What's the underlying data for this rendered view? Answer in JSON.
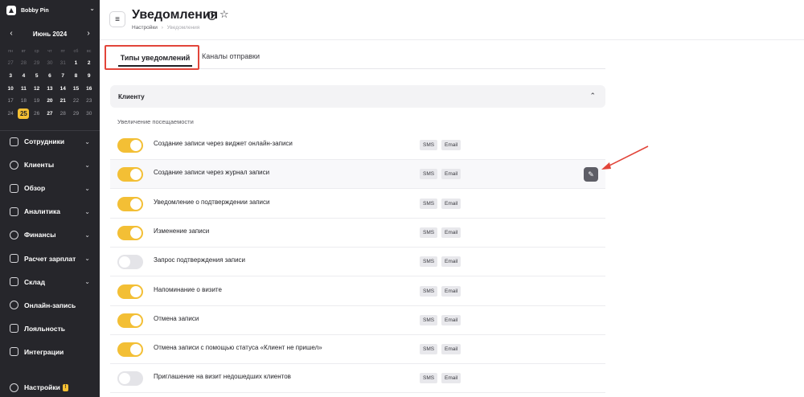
{
  "sidebar": {
    "org_name": "Bobby Pin",
    "calendar": {
      "month_label": "Июнь 2024",
      "weekdays": [
        "пн",
        "вт",
        "ср",
        "чт",
        "пт",
        "сб",
        "вс"
      ],
      "weeks": [
        [
          {
            "d": "27",
            "s": "muted"
          },
          {
            "d": "28",
            "s": "muted"
          },
          {
            "d": "29",
            "s": "muted"
          },
          {
            "d": "30",
            "s": "muted"
          },
          {
            "d": "31",
            "s": "muted"
          },
          {
            "d": "1",
            "s": ""
          },
          {
            "d": "2",
            "s": ""
          }
        ],
        [
          {
            "d": "3",
            "s": ""
          },
          {
            "d": "4",
            "s": ""
          },
          {
            "d": "5",
            "s": ""
          },
          {
            "d": "6",
            "s": ""
          },
          {
            "d": "7",
            "s": ""
          },
          {
            "d": "8",
            "s": ""
          },
          {
            "d": "9",
            "s": ""
          }
        ],
        [
          {
            "d": "10",
            "s": ""
          },
          {
            "d": "11",
            "s": ""
          },
          {
            "d": "12",
            "s": ""
          },
          {
            "d": "13",
            "s": ""
          },
          {
            "d": "14",
            "s": ""
          },
          {
            "d": "15",
            "s": ""
          },
          {
            "d": "16",
            "s": ""
          }
        ],
        [
          {
            "d": "17",
            "s": "wknd"
          },
          {
            "d": "18",
            "s": "wknd"
          },
          {
            "d": "19",
            "s": "wknd"
          },
          {
            "d": "20",
            "s": ""
          },
          {
            "d": "21",
            "s": ""
          },
          {
            "d": "22",
            "s": "wknd"
          },
          {
            "d": "23",
            "s": "wknd"
          }
        ],
        [
          {
            "d": "24",
            "s": "wknd"
          },
          {
            "d": "25",
            "s": "today"
          },
          {
            "d": "26",
            "s": "wknd"
          },
          {
            "d": "27",
            "s": ""
          },
          {
            "d": "28",
            "s": "wknd"
          },
          {
            "d": "29",
            "s": "wknd"
          },
          {
            "d": "30",
            "s": "wknd"
          }
        ]
      ]
    },
    "nav": [
      {
        "label": "Сотрудники",
        "icon": "employees-icon",
        "chevron": true
      },
      {
        "label": "Клиенты",
        "icon": "clients-icon",
        "chevron": true
      },
      {
        "label": "Обзор",
        "icon": "overview-icon",
        "chevron": true
      },
      {
        "label": "Аналитика",
        "icon": "analytics-icon",
        "chevron": true
      },
      {
        "label": "Финансы",
        "icon": "finance-icon",
        "chevron": true
      },
      {
        "label": "Расчет зарплат",
        "icon": "payroll-icon",
        "chevron": true
      },
      {
        "label": "Склад",
        "icon": "warehouse-icon",
        "chevron": true
      },
      {
        "label": "Онлайн-запись",
        "icon": "online-booking-icon",
        "chevron": false
      },
      {
        "label": "Лояльность",
        "icon": "loyalty-icon",
        "chevron": false
      },
      {
        "label": "Интеграции",
        "icon": "integrations-icon",
        "chevron": false
      }
    ],
    "settings_label": "Настройки",
    "settings_badge": "!"
  },
  "header": {
    "title": "Уведомления",
    "breadcrumb_parent": "Настройки",
    "breadcrumb_sep": "›",
    "breadcrumb_current": "Уведомления"
  },
  "tabs": [
    {
      "label": "Типы уведомлений",
      "active": true
    },
    {
      "label": "Каналы отправки",
      "active": false
    }
  ],
  "section": {
    "title": "Клиенту",
    "group_title": "Увеличение посещаемости"
  },
  "notifications": [
    {
      "label": "Создание записи через виджет онлайн-записи",
      "on": true,
      "channels": [
        "SMS",
        "Email"
      ]
    },
    {
      "label": "Создание записи через журнал записи",
      "on": true,
      "channels": [
        "SMS",
        "Email"
      ]
    },
    {
      "label": "Уведомление о подтверждении записи",
      "on": true,
      "channels": [
        "SMS",
        "Email"
      ]
    },
    {
      "label": "Изменение записи",
      "on": true,
      "channels": [
        "SMS",
        "Email"
      ]
    },
    {
      "label": "Запрос подтверждения записи",
      "on": false,
      "channels": [
        "SMS",
        "Email"
      ]
    },
    {
      "label": "Напоминание о визите",
      "on": true,
      "channels": [
        "SMS",
        "Email"
      ]
    },
    {
      "label": "Отмена записи",
      "on": true,
      "channels": [
        "SMS",
        "Email"
      ]
    },
    {
      "label": "Отмена записи с помощью статуса «Клиент не пришел»",
      "on": true,
      "channels": [
        "SMS",
        "Email"
      ]
    },
    {
      "label": "Приглашение на визит недошедших клиентов",
      "on": false,
      "channels": [
        "SMS",
        "Email"
      ]
    }
  ],
  "colors": {
    "sidebar_bg": "#26262b",
    "accent": "#f3bf35",
    "highlight_border": "#e2453a"
  }
}
